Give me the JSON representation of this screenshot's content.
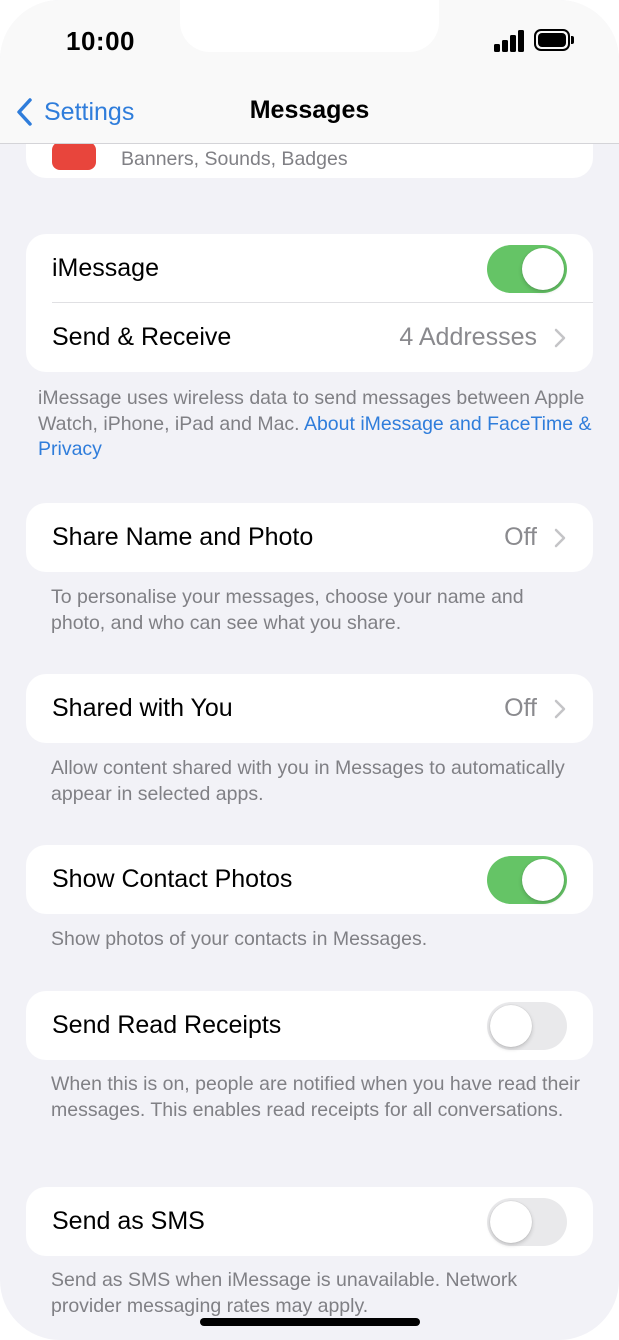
{
  "status_bar": {
    "time": "10:00"
  },
  "nav": {
    "back_label": "Settings",
    "title": "Messages"
  },
  "notifications_row": {
    "subtitle": "Banners, Sounds, Badges"
  },
  "imessage_group": {
    "imessage": {
      "label": "iMessage",
      "toggle": "on"
    },
    "send_receive": {
      "label": "Send & Receive",
      "value": "4 Addresses"
    }
  },
  "imessage_footer": {
    "text": "iMessage uses wireless data to send messages between Apple Watch, iPhone, iPad and Mac. ",
    "link": "About iMessage and FaceTime & Privacy"
  },
  "share_name": {
    "label": "Share Name and Photo",
    "value": "Off",
    "footer": "To personalise your messages, choose your name and photo, and who can see what you share."
  },
  "shared_with_you": {
    "label": "Shared with You",
    "value": "Off",
    "footer": "Allow content shared with you in Messages to automatically appear in selected apps."
  },
  "contact_photos": {
    "label": "Show Contact Photos",
    "toggle": "on",
    "footer": "Show photos of your contacts in Messages."
  },
  "read_receipts": {
    "label": "Send Read Receipts",
    "toggle": "off",
    "footer": "When this is on, people are notified when you have read their messages. This enables read receipts for all conversations."
  },
  "send_sms": {
    "label": "Send as SMS",
    "toggle": "off",
    "footer": "Send as SMS when iMessage is unavailable. Network provider messaging rates may apply."
  },
  "colors": {
    "accent": "#2f7ddb",
    "toggle_on": "#65c466",
    "toggle_off": "#e9e9eb",
    "background": "#f2f2f7",
    "secondary_text": "#8a8a8e"
  }
}
